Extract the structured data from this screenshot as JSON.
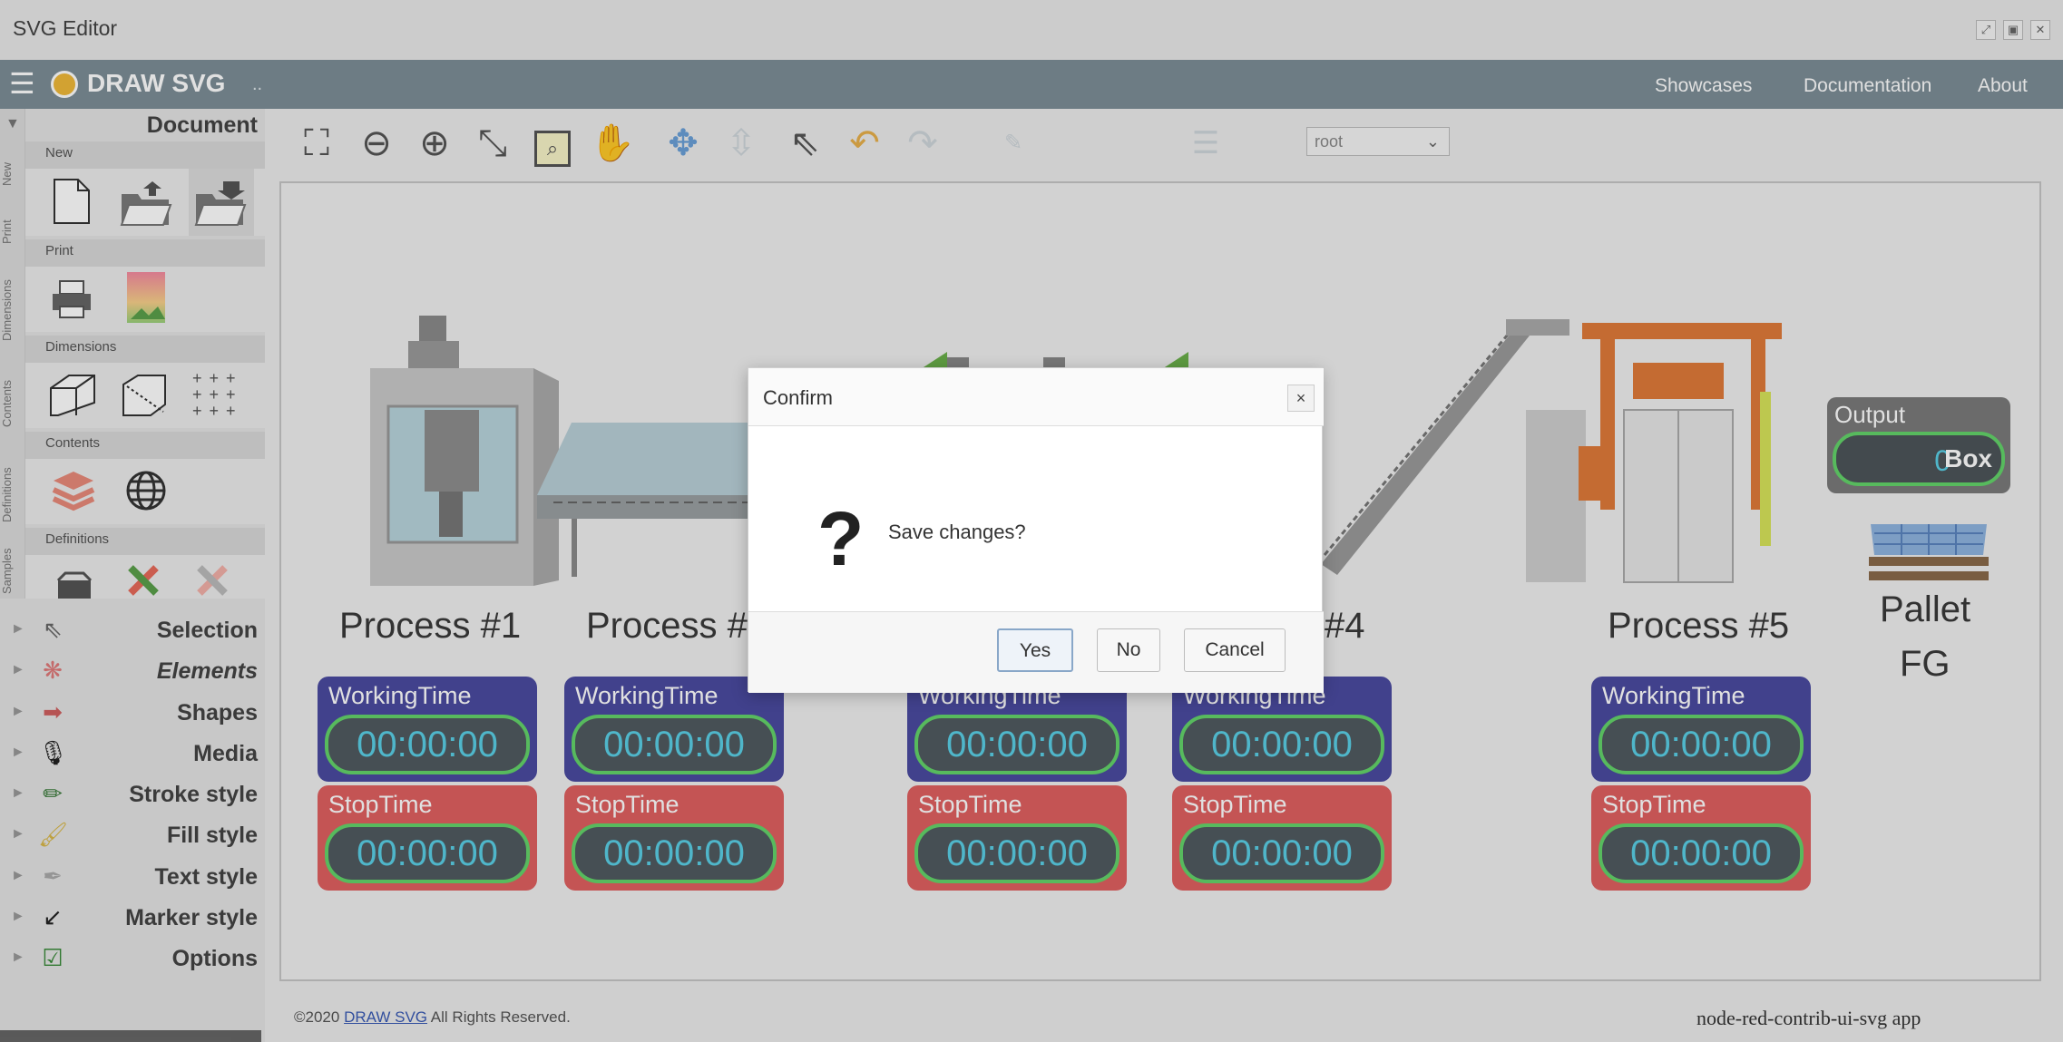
{
  "window": {
    "title": "SVG Editor"
  },
  "appbar": {
    "brand": "DRAW SVG",
    "dots": "..",
    "nav": [
      "Showcases",
      "Documentation",
      "About"
    ]
  },
  "leftpanel": {
    "vertical_tabs": [
      "New",
      "Print",
      "Dimensions",
      "Contents",
      "Definitions",
      "Samples"
    ],
    "document_title": "Document",
    "sections": {
      "new": "New",
      "print": "Print",
      "dimensions": "Dimensions",
      "contents": "Contents",
      "definitions": "Definitions"
    },
    "accordion": [
      "Selection",
      "Elements",
      "Shapes",
      "Media",
      "Stroke style",
      "Fill style",
      "Text style",
      "Marker style",
      "Options"
    ]
  },
  "toolbar": {
    "layer_select_value": "root"
  },
  "canvas": {
    "processes": [
      {
        "label": "Process #1",
        "working_title": "WorkingTime",
        "working_value": "00:00:00",
        "stop_title": "StopTime",
        "stop_value": "00:00:00"
      },
      {
        "label": "Process #2",
        "working_title": "WorkingTime",
        "working_value": "00:00:00",
        "stop_title": "StopTime",
        "stop_value": "00:00:00"
      },
      {
        "label": "",
        "working_title": "WorkingTime",
        "working_value": "00:00:00",
        "stop_title": "StopTime",
        "stop_value": "00:00:00"
      },
      {
        "label": "#4",
        "working_title": "WorkingTime",
        "working_value": "00:00:00",
        "stop_title": "StopTime",
        "stop_value": "00:00:00"
      },
      {
        "label": "Process #5",
        "working_title": "WorkingTime",
        "working_value": "00:00:00",
        "stop_title": "StopTime",
        "stop_value": "00:00:00"
      }
    ],
    "output": {
      "title": "Output",
      "value": "0",
      "unit": "Box"
    },
    "pallet_label_1": "Pallet",
    "pallet_label_2": "FG"
  },
  "footer": {
    "copyright_prefix": "©2020 ",
    "copyright_link": "DRAW SVG",
    "copyright_suffix": " All Rights Reserved.",
    "app_name": "node-red-contrib-ui-svg app"
  },
  "dialog": {
    "title": "Confirm",
    "close_symbol": "×",
    "message": "Save changes?",
    "buttons": {
      "yes": "Yes",
      "no": "No",
      "cancel": "Cancel"
    }
  },
  "colors": {
    "appbar": "#7d8e97",
    "working_panel": "#4a4aa0",
    "stop_panel": "#e06060",
    "timer_border": "#63d46a",
    "timer_text": "#5ad0e6"
  }
}
